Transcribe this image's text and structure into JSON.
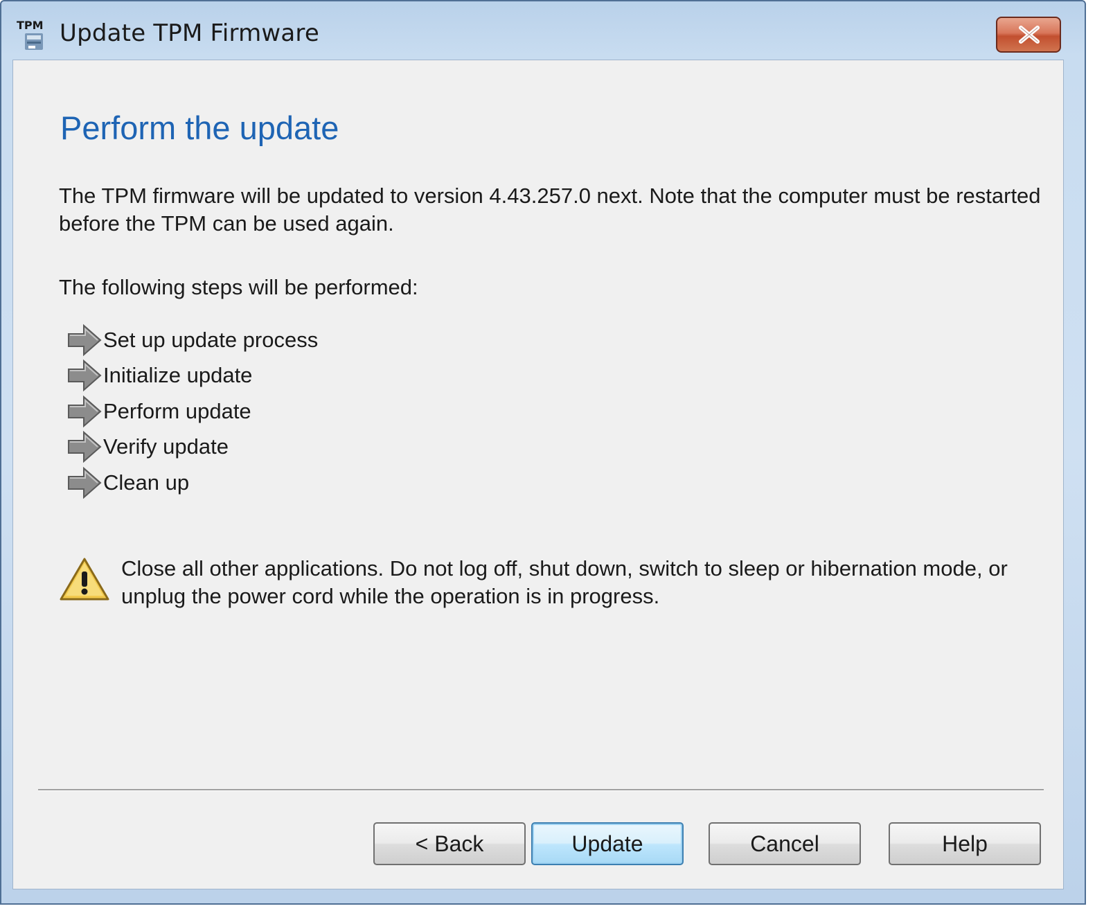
{
  "window": {
    "title": "Update TPM Firmware",
    "icon_label": "TPM"
  },
  "content": {
    "heading": "Perform the update",
    "description": "The TPM firmware will be updated to version 4.43.257.0 next. Note that the computer must be restarted before the TPM can be used again.",
    "steps_intro": "The following steps will be performed:",
    "steps": [
      {
        "label": "Set up update process",
        "icon": "arrow-right-icon"
      },
      {
        "label": "Initialize update",
        "icon": "arrow-right-icon"
      },
      {
        "label": "Perform update",
        "icon": "arrow-right-icon"
      },
      {
        "label": "Verify update",
        "icon": "arrow-right-icon"
      },
      {
        "label": "Clean up",
        "icon": "arrow-right-icon"
      }
    ],
    "warning_icon": "warning-icon",
    "warning": "Close all other applications. Do not log off, shut down, switch to sleep or hibernation mode, or unplug the power cord while the operation is in progress."
  },
  "buttons": {
    "back": "< Back",
    "update": "Update",
    "cancel": "Cancel",
    "help": "Help"
  },
  "colors": {
    "heading": "#1e64b4",
    "client_bg": "#f0f0f0",
    "close_button": "#c24f2f",
    "default_button_border": "#3c7fb1"
  }
}
